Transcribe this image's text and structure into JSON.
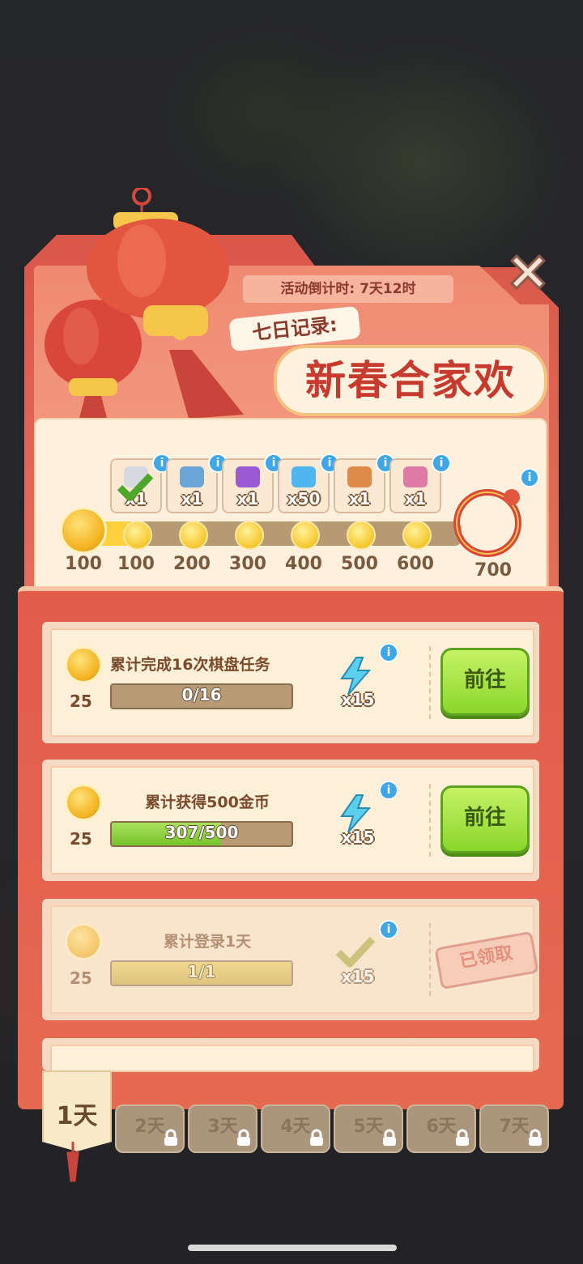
{
  "header": {
    "countdown": "活动倒计时: 7天12时",
    "subtitle": "七日记录:",
    "title": "新春合家欢"
  },
  "progress": {
    "start_label": "100",
    "current_points": 120,
    "max_points": 700,
    "milestones": [
      {
        "label": "100",
        "qty": "x1",
        "item": "silver-frame-icon",
        "claimed": true
      },
      {
        "label": "200",
        "qty": "x1",
        "item": "camera-box-icon",
        "claimed": false
      },
      {
        "label": "300",
        "qty": "x1",
        "item": "purple-chest-icon",
        "claimed": false
      },
      {
        "label": "400",
        "qty": "x50",
        "item": "diamond-icon",
        "claimed": false
      },
      {
        "label": "500",
        "qty": "x1",
        "item": "orange-chest-icon",
        "claimed": false
      },
      {
        "label": "600",
        "qty": "x1",
        "item": "pink-cup-icon",
        "claimed": false
      }
    ],
    "final_label": "700"
  },
  "tasks": [
    {
      "title": "累计完成16次棋盘任务",
      "points": "25",
      "progress_text": "0/16",
      "progress": 0.0,
      "reward_qty": "x15",
      "button": "前往",
      "claimed": false
    },
    {
      "title": "累计获得500金币",
      "points": "25",
      "progress_text": "307/500",
      "progress": 0.614,
      "reward_qty": "x15",
      "button": "前往",
      "claimed": false
    },
    {
      "title": "累计登录1天",
      "points": "25",
      "progress_text": "1/1",
      "progress": 1.0,
      "reward_qty": "x15",
      "button": "已领取",
      "claimed": true
    }
  ],
  "tabs": [
    {
      "label": "1天",
      "active": true
    },
    {
      "label": "2天",
      "locked": true
    },
    {
      "label": "3天",
      "locked": true
    },
    {
      "label": "4天",
      "locked": true
    },
    {
      "label": "5天",
      "locked": true
    },
    {
      "label": "6天",
      "locked": true
    },
    {
      "label": "7天",
      "locked": true
    }
  ],
  "info_badge": "i",
  "colors": {
    "panel_red": "#e25c4a",
    "go_green": "#8ad62c",
    "coin_gold": "#f3b321"
  }
}
